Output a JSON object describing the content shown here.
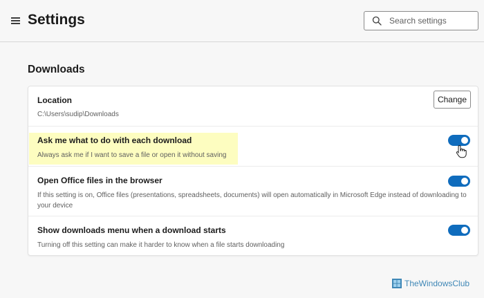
{
  "header": {
    "title": "Settings",
    "search_placeholder": "Search settings"
  },
  "section": {
    "title": "Downloads"
  },
  "rows": [
    {
      "title": "Location",
      "desc": "C:\\Users\\sudip\\Downloads",
      "button_label": "Change"
    },
    {
      "title": "Ask me what to do with each download",
      "desc": "Always ask me if I want to save a file or open it without saving",
      "toggle_on": true
    },
    {
      "title": "Open Office files in the browser",
      "desc": "If this setting is on, Office files (presentations, spreadsheets, documents) will open automatically in Microsoft Edge instead of downloading to your device",
      "toggle_on": true
    },
    {
      "title": "Show downloads menu when a download starts",
      "desc": "Turning off this setting can make it harder to know when a file starts downloading",
      "toggle_on": true
    }
  ],
  "watermark": {
    "text": "TheWindowsClub"
  },
  "colors": {
    "accent": "#0f6cbd",
    "highlight": "#fdfdc0",
    "watermark": "#3f87b6"
  }
}
